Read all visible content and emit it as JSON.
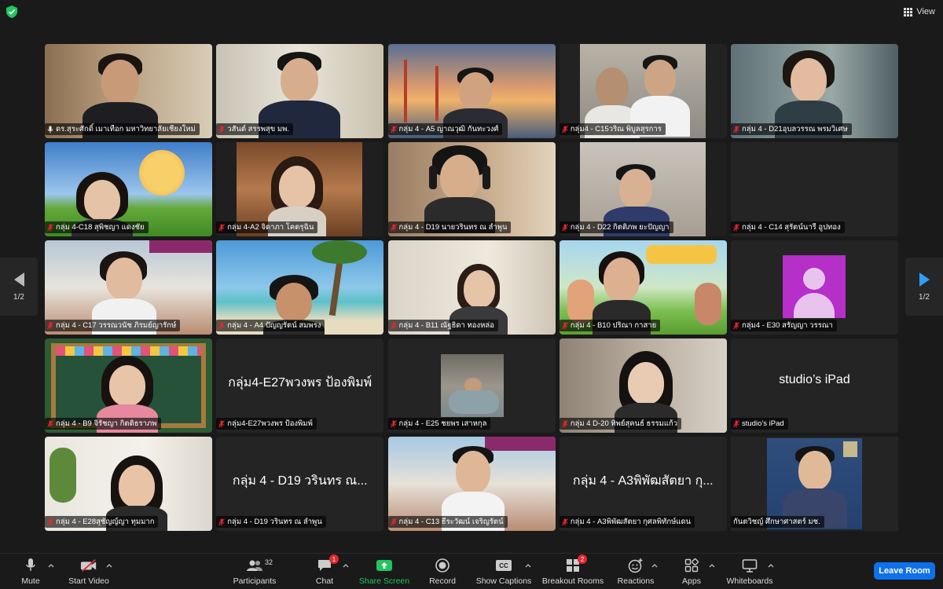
{
  "topbar": {
    "view_label": "View"
  },
  "pager": {
    "left_page": "1/2",
    "right_page": "1/2"
  },
  "participants": [
    {
      "name": "ดร.สุระศักดิ์ เมาเทือก มหาวิทยาลัยเชียงใหม่",
      "mic": "on"
    },
    {
      "name": "วสันต์ สรรพสุข มพ.",
      "mic": "muted"
    },
    {
      "name": "กลุ่ม 4 - A5 ญาณวุฒิ กันทะวงศ์",
      "mic": "muted"
    },
    {
      "name": "กลุ่ม4 - C15วริณ พิบูลสุรการ",
      "mic": "muted"
    },
    {
      "name": "กลุ่ม 4 - D21อุบลวรรณ พรมวิเศษ",
      "mic": "muted"
    },
    {
      "name": "กลุ่ม 4-C18 สุพิชญา แดงชัย",
      "mic": "muted"
    },
    {
      "name": "กลุ่ม 4-A2 จิดาภา โคตรุฉิน",
      "mic": "muted"
    },
    {
      "name": "กลุ่ม 4 - D19 นายวรินทร ณ ลำพูน",
      "mic": "muted"
    },
    {
      "name": "กลุ่ม 4 - D22 กิตติภพ ยะปัญญา",
      "mic": "muted"
    },
    {
      "name": "กลุ่ม 4 - C14 สุรัตน์นารี อูปทอง",
      "mic": "muted"
    },
    {
      "name": "กลุ่ม 4 - C17 วรรณวนัช ภิรมย์ญารักษ์",
      "mic": "muted"
    },
    {
      "name": "กลุ่ม 4 - A4 ปัญญรัตน์ สมพรง",
      "mic": "muted"
    },
    {
      "name": "กลุ่ม 4 - B11 ณัฐธิดา ทองหล่อ",
      "mic": "muted"
    },
    {
      "name": "กลุ่ม 4 - B10 ปริณา กาสาย",
      "mic": "muted"
    },
    {
      "name": "กลุ่ม4 - E30 สรัญญา วรรณา",
      "mic": "muted"
    },
    {
      "name": "กลุ่ม 4 - B9 จิรัชญา กิตติธราภพ",
      "mic": "muted"
    },
    {
      "name": "กลุ่ม4-E27พวงพร ป้องพิมพ์",
      "mic": "muted",
      "big": "กลุ่ม4-E27พวงพร ป้องพิมพ์"
    },
    {
      "name": "กลุ่ม 4 - E25 ชยพร เสาหกุล",
      "mic": "muted"
    },
    {
      "name": "กลุ่ม 4 D-20 ทิพย์สุคนธ์ ธรรมแก้ว",
      "mic": "muted"
    },
    {
      "name": "studio’s iPad",
      "mic": "muted",
      "big": "studio’s iPad"
    },
    {
      "name": "กลุ่ม 4 - E28สุชัญญ์ญา ทุมมาก",
      "mic": "muted"
    },
    {
      "name": "กลุ่ม 4 - D19 วรินทร ณ ลำพูน",
      "mic": "muted",
      "big": "กลุ่ม 4 - D19 วรินทร ณ..."
    },
    {
      "name": "กลุ่ม 4 - C13 ธีระวัฒน์ เจริญรัตน์",
      "mic": "muted"
    },
    {
      "name": "กลุ่ม 4 - A3พิพัฒสัตยา กุศลพิทักษ์แดน",
      "mic": "muted",
      "big": "กลุ่ม 4 - A3พิพัฒสัตยา กุ..."
    },
    {
      "name": "กันตวิชญ์ ศึกษาศาสตร์ มช.",
      "mic": "on"
    }
  ],
  "toolbar": {
    "mute": "Mute",
    "start_video": "Start Video",
    "participants": "Participants",
    "participants_count": "32",
    "chat": "Chat",
    "chat_badge": "1",
    "share_screen": "Share Screen",
    "record": "Record",
    "show_captions": "Show Captions",
    "cc": "CC",
    "breakout_rooms": "Breakout Rooms",
    "breakout_badge": "2",
    "reactions": "Reactions",
    "apps": "Apps",
    "whiteboards": "Whiteboards",
    "leave_room": "Leave Room"
  },
  "colors": {
    "share_green": "#22c55e",
    "leave_blue": "#0e71eb",
    "badge_red": "#e5262e",
    "active_speaker": "#23d959",
    "pager_arrow_blue": "#2f9cf5"
  }
}
